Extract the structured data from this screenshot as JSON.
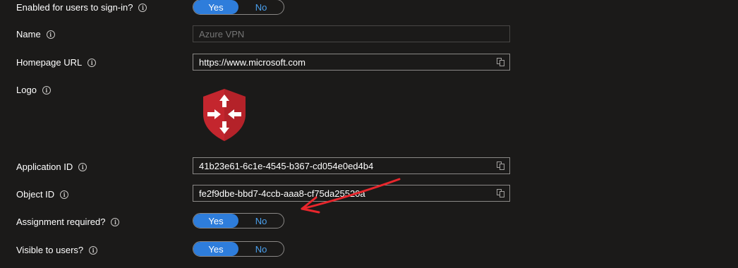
{
  "rows": {
    "enabled": {
      "label": "Enabled for users to sign-in?",
      "yes": "Yes",
      "no": "No"
    },
    "name": {
      "label": "Name",
      "placeholder": "Azure VPN"
    },
    "homepage": {
      "label": "Homepage URL",
      "value": "https://www.microsoft.com"
    },
    "logo": {
      "label": "Logo"
    },
    "application_id": {
      "label": "Application ID",
      "value": "41b23e61-6c1e-4545-b367-cd054e0ed4b4"
    },
    "object_id": {
      "label": "Object ID",
      "value": "fe2f9dbe-bbd7-4ccb-aaa8-cf75da25520a"
    },
    "assignment": {
      "label": "Assignment required?",
      "yes": "Yes",
      "no": "No"
    },
    "visible": {
      "label": "Visible to users?",
      "yes": "Yes",
      "no": "No"
    }
  },
  "info_glyph": "i",
  "colors": {
    "background": "#1b1a19",
    "toggle_on": "#2e7ddb",
    "toggle_off_text": "#4aa0ee",
    "shield_red": "#c4262e",
    "annotation_arrow": "#e8262c"
  },
  "icons": {
    "logo": "azure-vpn-shield-icon",
    "copy": "copy-icon",
    "info": "info-icon"
  }
}
